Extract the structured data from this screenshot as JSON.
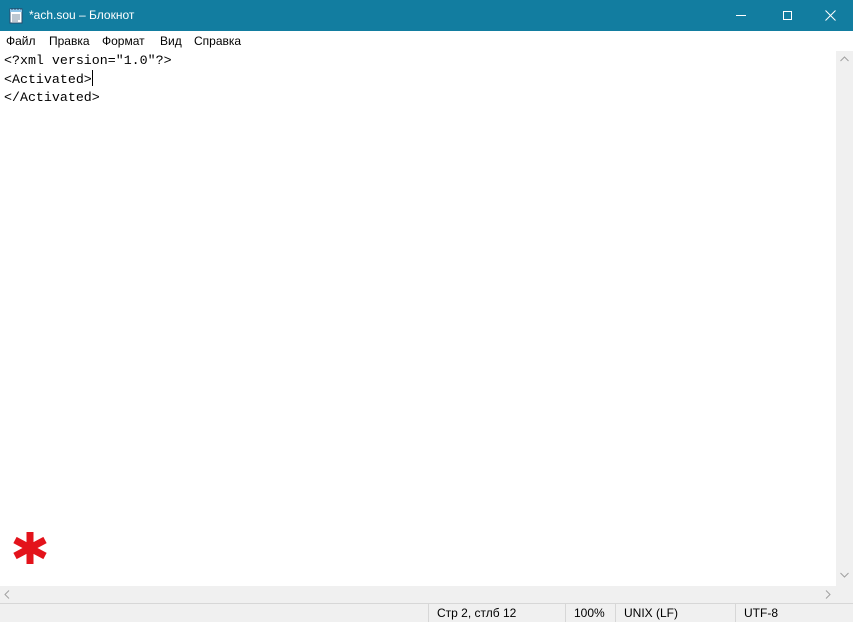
{
  "window": {
    "title": "*ach.sou – Блокнот",
    "icons": {
      "app": "notepad-icon",
      "minimize": "minimize-icon",
      "maximize": "maximize-icon",
      "close": "close-icon"
    }
  },
  "menu": {
    "file": "Файл",
    "edit": "Правка",
    "format": "Формат",
    "view": "Вид",
    "help": "Справка"
  },
  "editor": {
    "lines": [
      "<?xml version=\"1.0\"?>",
      "<Activated>",
      "</Activated>"
    ],
    "overlay_icon": "red-asterisk-icon"
  },
  "status": {
    "position": "Стр 2, стлб 12",
    "zoom": "100%",
    "line_endings": "UNIX (LF)",
    "encoding": "UTF-8"
  },
  "colors": {
    "titlebar": "#127da0",
    "asterisk": "#e3131b"
  }
}
